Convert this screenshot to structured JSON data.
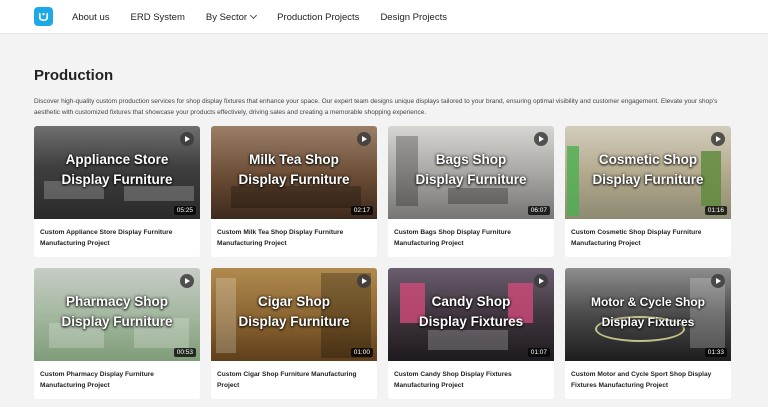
{
  "header": {
    "logo_icon": "brand-logo-icon",
    "logo_color": "#1fa8e8",
    "nav": [
      {
        "label": "About us"
      },
      {
        "label": "ERD System"
      },
      {
        "label": "By Sector",
        "has_dropdown": true
      },
      {
        "label": "Production Projects"
      },
      {
        "label": "Design Projects"
      }
    ]
  },
  "main": {
    "title": "Production",
    "intro": "Discover high-quality custom production services for shop display fixtures that enhance your space. Our expert team designs unique displays tailored to your brand, ensuring optimal visibility and customer engagement. Elevate your shop's aesthetic with customized fixtures that showcase your products effectively, driving sales and creating a memorable shopping experience."
  },
  "cards": [
    {
      "overlay_line1": "Appliance Store",
      "overlay_line2": "Display Furniture",
      "duration": "05:25",
      "caption": "Custom Appliance Store Display Furniture Manufacturing Project"
    },
    {
      "overlay_line1": "Milk Tea Shop",
      "overlay_line2": "Display Furniture",
      "duration": "02:17",
      "caption": "Custom Milk Tea Shop Display Furniture Manufacturing Project"
    },
    {
      "overlay_line1": "Bags Shop",
      "overlay_line2": "Display Furniture",
      "duration": "06:07",
      "caption": "Custom Bags Shop Display Furniture Manufacturing Project"
    },
    {
      "overlay_line1": "Cosmetic Shop",
      "overlay_line2": "Display Furniture",
      "duration": "01:16",
      "caption": "Custom Cosmetic Shop Display Furniture Manufacturing Project"
    },
    {
      "overlay_line1": "Pharmacy Shop",
      "overlay_line2": "Display Furniture",
      "duration": "00:53",
      "caption": "Custom Pharmacy Display Furniture Manufacturing Project"
    },
    {
      "overlay_line1": "Cigar Shop",
      "overlay_line2": "Display Furniture",
      "duration": "01:00",
      "caption": "Custom Cigar Shop Furniture Manufacturing Project"
    },
    {
      "overlay_line1": "Candy Shop",
      "overlay_line2": "Display Fixtures",
      "duration": "01:07",
      "caption": "Custom Candy Shop Display Fixtures Manufacturing Project"
    },
    {
      "overlay_line1": "Motor & Cycle Shop",
      "overlay_line2": "Display Fixtures",
      "duration": "01:33",
      "caption": "Custom Motor and Cycle Sport Shop Display Fixtures Manufacturing Project"
    }
  ]
}
